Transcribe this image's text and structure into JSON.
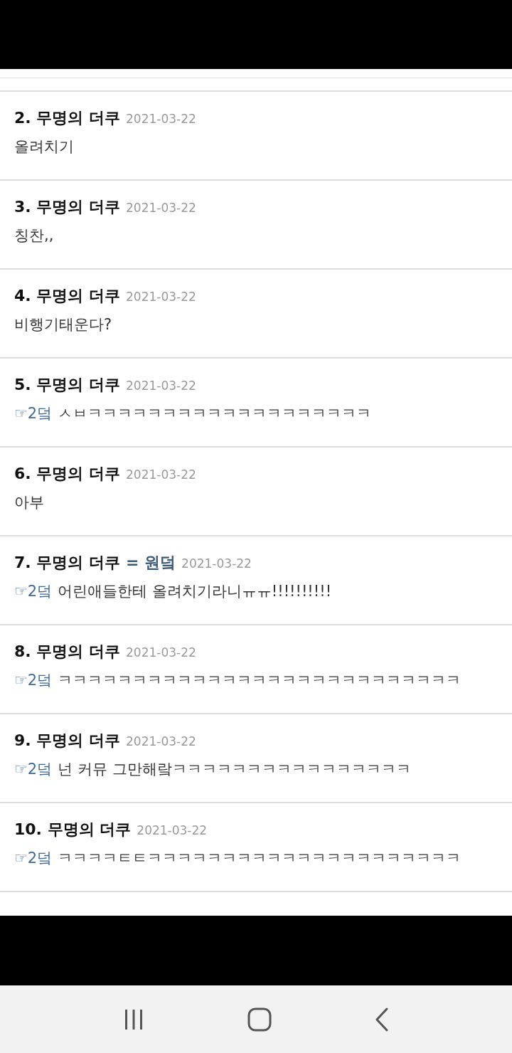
{
  "comments": [
    {
      "number": "2.",
      "author": "무명의 더쿠",
      "date": "2021-03-22",
      "text": "올려치기"
    },
    {
      "number": "3.",
      "author": "무명의 더쿠",
      "date": "2021-03-22",
      "text": "칭찬,,"
    },
    {
      "number": "4.",
      "author": "무명의 더쿠",
      "date": "2021-03-22",
      "text": "비행기태운다?"
    },
    {
      "number": "5.",
      "author": "무명의 더쿠",
      "date": "2021-03-22",
      "reply_to": "☞2덬",
      "text": "ㅅㅂㅋㅋㅋㅋㅋㅋㅋㅋㅋㅋㅋㅋㅋㅋㅋㅋㅋㅋㅋ"
    },
    {
      "number": "6.",
      "author": "무명의 더쿠",
      "date": "2021-03-22",
      "text": "아부"
    },
    {
      "number": "7.",
      "author": "무명의 더쿠",
      "alias": "= 원덬",
      "date": "2021-03-22",
      "reply_to": "☞2덬",
      "text": "어린애들한테 올려치기라니ㅠㅠ!!!!!!!!!!"
    },
    {
      "number": "8.",
      "author": "무명의 더쿠",
      "date": "2021-03-22",
      "reply_to": "☞2덬",
      "text": "ㅋㅋㅋㅋㅋㅋㅋㅋㅋㅋㅋㅋㅋㅋㅋㅋㅋㅋㅋㅋㅋㅋㅋㅋㅋㅋㅋ"
    },
    {
      "number": "9.",
      "author": "무명의 더쿠",
      "date": "2021-03-22",
      "reply_to": "☞2덬",
      "text": "넌 커뮤 그만해랔ㅋㅋㅋㅋㅋㅋㅋㅋㅋㅋㅋㅋㅋㅋㅋㅋ"
    },
    {
      "number": "10.",
      "author": "무명의 더쿠",
      "date": "2021-03-22",
      "reply_to": "☞2덬",
      "text": "ㅋㅋㅋㅋㅌㅌㅋㅋㅋㅋㅋㅋㅋㅋㅋㅋㅋㅋㅋㅋㅋㅋㅋㅋㅋㅋㅋ"
    }
  ]
}
